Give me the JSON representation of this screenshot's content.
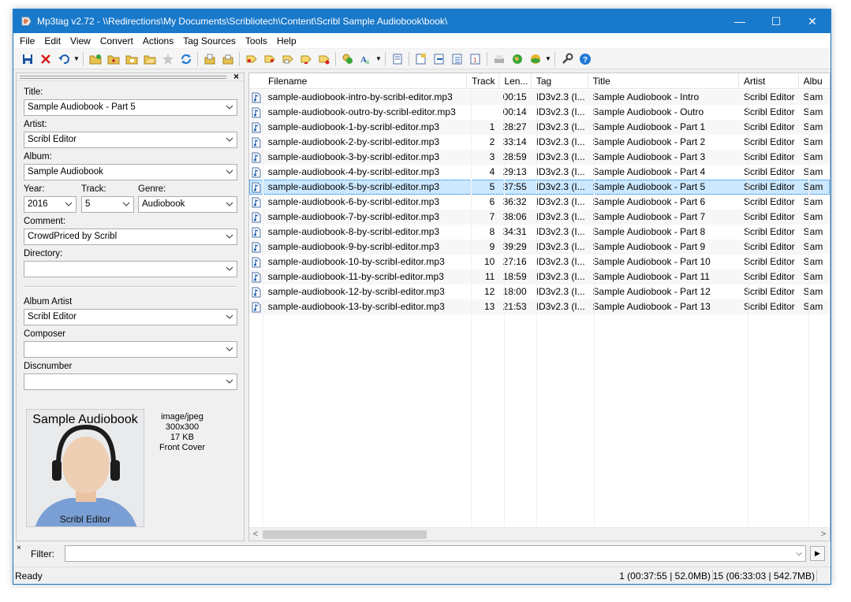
{
  "window": {
    "title": "Mp3tag v2.72  -  \\\\Redirections\\My Documents\\Scribliotech\\Content\\Scribl Sample Audiobook\\book\\",
    "minimize": "—",
    "maximize": "☐",
    "close": "✕"
  },
  "menu": [
    "File",
    "Edit",
    "View",
    "Convert",
    "Actions",
    "Tag Sources",
    "Tools",
    "Help"
  ],
  "panel": {
    "close": "×",
    "title_label": "Title:",
    "title_value": "Sample Audiobook - Part 5",
    "artist_label": "Artist:",
    "artist_value": "Scribl Editor",
    "album_label": "Album:",
    "album_value": "Sample Audiobook",
    "year_label": "Year:",
    "year_value": "2016",
    "track_label": "Track:",
    "track_value": "5",
    "genre_label": "Genre:",
    "genre_value": "Audiobook",
    "comment_label": "Comment:",
    "comment_value": "CrowdPriced by Scribl",
    "directory_label": "Directory:",
    "directory_value": "",
    "album_artist_label": "Album Artist",
    "album_artist_value": "Scribl Editor",
    "composer_label": "Composer",
    "composer_value": "",
    "discnumber_label": "Discnumber",
    "discnumber_value": "",
    "cover": {
      "top_text": "Sample Audiobook",
      "bottom_text": "Scribl Editor",
      "mime": "image/jpeg",
      "dimensions": "300x300",
      "size": "17 KB",
      "type": "Front Cover"
    }
  },
  "columns": [
    "Filename",
    "Track",
    "Len...",
    "Tag",
    "Title",
    "Artist",
    "Albu"
  ],
  "rows": [
    {
      "filename": "sample-audiobook-intro-by-scribl-editor.mp3",
      "track": "",
      "length": "00:15",
      "tag": "ID3v2.3 (I...",
      "title": "Sample Audiobook - Intro",
      "artist": "Scribl Editor",
      "album": "Sam"
    },
    {
      "filename": "sample-audiobook-outro-by-scribl-editor.mp3",
      "track": "",
      "length": "00:14",
      "tag": "ID3v2.3 (I...",
      "title": "Sample Audiobook - Outro",
      "artist": "Scribl Editor",
      "album": "Sam"
    },
    {
      "filename": "sample-audiobook-1-by-scribl-editor.mp3",
      "track": "1",
      "length": "28:27",
      "tag": "ID3v2.3 (I...",
      "title": "Sample Audiobook - Part 1",
      "artist": "Scribl Editor",
      "album": "Sam"
    },
    {
      "filename": "sample-audiobook-2-by-scribl-editor.mp3",
      "track": "2",
      "length": "33:14",
      "tag": "ID3v2.3 (I...",
      "title": "Sample Audiobook - Part 2",
      "artist": "Scribl Editor",
      "album": "Sam"
    },
    {
      "filename": "sample-audiobook-3-by-scribl-editor.mp3",
      "track": "3",
      "length": "28:59",
      "tag": "ID3v2.3 (I...",
      "title": "Sample Audiobook - Part 3",
      "artist": "Scribl Editor",
      "album": "Sam"
    },
    {
      "filename": "sample-audiobook-4-by-scribl-editor.mp3",
      "track": "4",
      "length": "29:13",
      "tag": "ID3v2.3 (I...",
      "title": "Sample Audiobook - Part 4",
      "artist": "Scribl Editor",
      "album": "Sam"
    },
    {
      "filename": "sample-audiobook-5-by-scribl-editor.mp3",
      "track": "5",
      "length": "37:55",
      "tag": "ID3v2.3 (I...",
      "title": "Sample Audiobook - Part 5",
      "artist": "Scribl Editor",
      "album": "Sam",
      "selected": true
    },
    {
      "filename": "sample-audiobook-6-by-scribl-editor.mp3",
      "track": "6",
      "length": "36:32",
      "tag": "ID3v2.3 (I...",
      "title": "Sample Audiobook - Part 6",
      "artist": "Scribl Editor",
      "album": "Sam"
    },
    {
      "filename": "sample-audiobook-7-by-scribl-editor.mp3",
      "track": "7",
      "length": "38:06",
      "tag": "ID3v2.3 (I...",
      "title": "Sample Audiobook - Part 7",
      "artist": "Scribl Editor",
      "album": "Sam"
    },
    {
      "filename": "sample-audiobook-8-by-scribl-editor.mp3",
      "track": "8",
      "length": "34:31",
      "tag": "ID3v2.3 (I...",
      "title": "Sample Audiobook - Part 8",
      "artist": "Scribl Editor",
      "album": "Sam"
    },
    {
      "filename": "sample-audiobook-9-by-scribl-editor.mp3",
      "track": "9",
      "length": "39:29",
      "tag": "ID3v2.3 (I...",
      "title": "Sample Audiobook - Part 9",
      "artist": "Scribl Editor",
      "album": "Sam"
    },
    {
      "filename": "sample-audiobook-10-by-scribl-editor.mp3",
      "track": "10",
      "length": "27:16",
      "tag": "ID3v2.3 (I...",
      "title": "Sample Audiobook - Part 10",
      "artist": "Scribl Editor",
      "album": "Sam"
    },
    {
      "filename": "sample-audiobook-11-by-scribl-editor.mp3",
      "track": "11",
      "length": "18:59",
      "tag": "ID3v2.3 (I...",
      "title": "Sample Audiobook - Part 11",
      "artist": "Scribl Editor",
      "album": "Sam"
    },
    {
      "filename": "sample-audiobook-12-by-scribl-editor.mp3",
      "track": "12",
      "length": "18:00",
      "tag": "ID3v2.3 (I...",
      "title": "Sample Audiobook - Part 12",
      "artist": "Scribl Editor",
      "album": "Sam"
    },
    {
      "filename": "sample-audiobook-13-by-scribl-editor.mp3",
      "track": "13",
      "length": "21:53",
      "tag": "ID3v2.3 (I...",
      "title": "Sample Audiobook - Part 13",
      "artist": "Scribl Editor",
      "album": "Sam"
    }
  ],
  "filter": {
    "label": "Filter:",
    "value": ""
  },
  "status": {
    "ready": "Ready",
    "selection": "1 (00:37:55 | 52.0MB)",
    "total": "15 (06:33:03 | 542.7MB)"
  },
  "colors": {
    "accent": "#1979ca",
    "selection": "#cce8ff",
    "alt_row": "#f7f7f7"
  }
}
